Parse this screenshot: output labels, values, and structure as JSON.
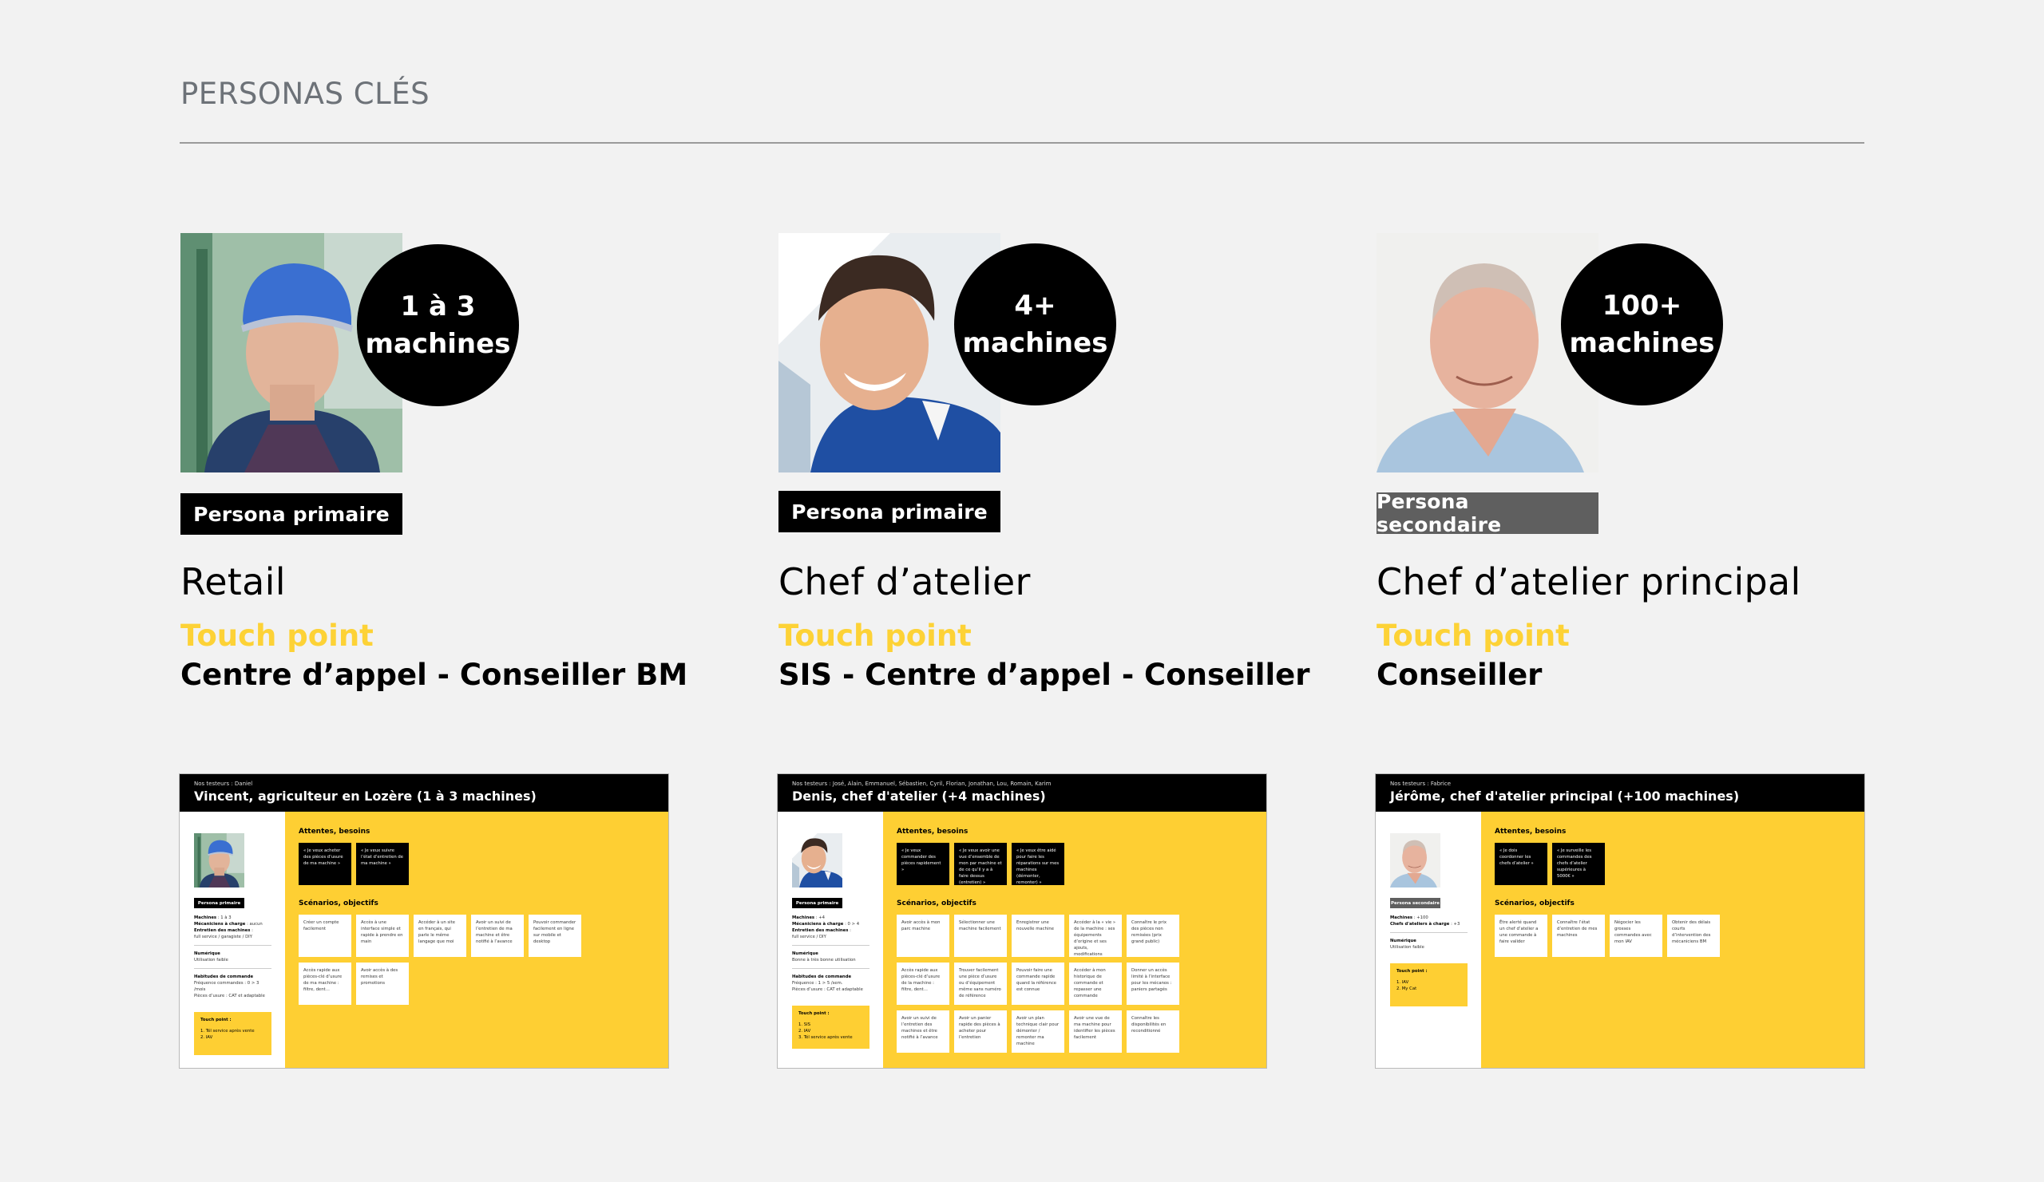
{
  "page": {
    "title": "PERSONAS CLÉS",
    "accent_color": "#fdd236",
    "background_color": "#f2f2f2"
  },
  "personas": [
    {
      "count_line1": "1 à 3",
      "count_line2": "machines",
      "badge": "Persona primaire",
      "badge_type": "primary",
      "role": "Retail",
      "touch_point_label": "Touch point",
      "touch_point_value": "Centre d’appel - Conseiller BM",
      "photo": "farmer-portrait"
    },
    {
      "count_line1": "4+",
      "count_line2": "machines",
      "badge": "Persona primaire",
      "badge_type": "primary",
      "role": "Chef d’atelier",
      "touch_point_label": "Touch point",
      "touch_point_value": "SIS - Centre d’appel - Conseiller",
      "photo": "mechanic-portrait"
    },
    {
      "count_line1": "100+",
      "count_line2": "machines",
      "badge": "Persona secondaire",
      "badge_type": "secondary",
      "role": "Chef d’atelier principal",
      "touch_point_label": "Touch point",
      "touch_point_value": "Conseiller",
      "photo": "senior-manager-portrait"
    }
  ],
  "docs": [
    {
      "testers": "Nos testeurs : Daniel",
      "title": "Vincent, agriculteur en Lozère (1 à 3 machines)",
      "badge": "Persona primaire",
      "info": [
        {
          "lines": [
            {
              "label": "Machines",
              "value": " : 1 à 3"
            },
            {
              "label": "Mécaniciens à charge",
              "value": " : aucun"
            },
            {
              "label": "Entretien des machines",
              "value": " :"
            },
            {
              "label": "",
              "value": "full service / garagiste / DIY"
            }
          ]
        },
        {
          "lines": [
            {
              "label": "Numérique",
              "value": ""
            },
            {
              "label": "",
              "value": "Utilisation faible"
            }
          ]
        },
        {
          "lines": [
            {
              "label": "Habitudes de commande",
              "value": ""
            },
            {
              "label": "",
              "value": "Fréquence commandes : 0 > 3 /mois"
            },
            {
              "label": "",
              "value": "Pièces d’usure : CAT et adaptable"
            }
          ]
        }
      ],
      "touch_point_title": "Touch point :",
      "touch_points": [
        "1. Tél service après vente",
        "2. IAV"
      ],
      "needs_title": "Attentes, besoins",
      "needs": [
        "« Je veux acheter des pièces d’usure de ma machine »",
        "« Je veux suivre l’état d’entretien de ma machine »"
      ],
      "scenarios_title": "Scénarios, objectifs",
      "scenarios": [
        "Créer un compte facilement",
        "Accès à une interface simple et rapide à prendre en main",
        "Accéder à un site en français, qui parle le même langage que moi",
        "Avoir un suivi de l’entretien de ma machine et être notifié à l’avance",
        "Pouvoir commander facilement en ligne sur mobile et desktop",
        "Accès rapide aux pièces-clé d’usure de ma machine : filtre, dent…",
        "Avoir accès à des remises et promotions"
      ]
    },
    {
      "testers": "Nos testeurs : José, Alain, Emmanuel, Sébastien, Cyril, Florian, Jonathan, Lou, Romain, Karim",
      "title": "Denis, chef d'atelier (+4 machines)",
      "badge": "Persona primaire",
      "info": [
        {
          "lines": [
            {
              "label": "Machines",
              "value": " : +4"
            },
            {
              "label": "Mécaniciens à charge",
              "value": " : 0 > 4"
            },
            {
              "label": "Entretien des machines",
              "value": " :"
            },
            {
              "label": "",
              "value": "full service / DIY"
            }
          ]
        },
        {
          "lines": [
            {
              "label": "Numérique",
              "value": ""
            },
            {
              "label": "",
              "value": "Bonne à très bonne utilisation"
            }
          ]
        },
        {
          "lines": [
            {
              "label": "Habitudes de commande",
              "value": ""
            },
            {
              "label": "",
              "value": "Fréquence : 1 > 5 /sem."
            },
            {
              "label": "",
              "value": "Pièces d’usure : CAT et adaptable"
            }
          ]
        }
      ],
      "touch_point_title": "Touch point :",
      "touch_points": [
        "1. SIS",
        "2. IAV",
        "3. Tél service après vente"
      ],
      "needs_title": "Attentes, besoins",
      "needs": [
        "« Je veux commander des pièces rapidement »",
        "« Je veux avoir une vue d’ensemble de mon par machine et de ce qu’il y a à faire dessus (entretien) »",
        "« Je veux être aidé pour faire les réparations sur mes machines (démonter, remonter) »"
      ],
      "scenarios_title": "Scénarios, objectifs",
      "scenarios": [
        "Avoir accès à mon parc machine",
        "Sélectionner une machine facilement",
        "Enregistrer une nouvelle machine",
        "Accéder à la « vie » de la machine : ses équipements d’origine et ses ajouts, modifications",
        "Connaître le prix des pièces non remisées (prix grand public)",
        "Accès rapide aux pièces-clé d’usure de la machine : filtre, dent…",
        "Trouver facilement une pièce d’usure ou d’équipement même sans numéro de référence",
        "Pouvoir faire une commande rapide quand la référence est connue",
        "Accéder à mon historique de commande et repasser une commande",
        "Donner un accès limité à l’interface pour les mécanos : paniers partagés",
        "Avoir un suivi de l’entretien des machines et être notifié à l’avance",
        "Avoir un panier rapide des pièces à acheter pour l’entretien",
        "Avoir un plan technique clair pour démonter / remonter ma machine",
        "Avoir une vue de ma machine pour identifier les pièces facilement",
        "Connaître les disponibilités en reconditionné"
      ]
    },
    {
      "testers": "Nos testeurs : Fabrice",
      "title": "Jérôme, chef d'atelier principal (+100 machines)",
      "badge": "Persona secondaire",
      "info": [
        {
          "lines": [
            {
              "label": "Machines",
              "value": " : +100"
            },
            {
              "label": "Chefs d'ateliers à charge",
              "value": " : +3"
            }
          ]
        },
        {
          "lines": [
            {
              "label": "Numérique",
              "value": ""
            },
            {
              "label": "",
              "value": "Utilisation faible"
            }
          ]
        }
      ],
      "touch_point_title": "Touch point :",
      "touch_points": [
        "1. IAV",
        "2. My Cat"
      ],
      "needs_title": "Attentes, besoins",
      "needs": [
        "« Je dois coordonner les chefs d’atelier »",
        "« Je surveille les commandes des chefs d’atelier supérieures à 5000€ »"
      ],
      "scenarios_title": "Scénarios, objectifs",
      "scenarios": [
        "Être alerté quand un chef d’atelier a une commande à faire valider",
        "Connaître l’état d’entretien de mes machines",
        "Négocier les grosses commandes avec mon IAV",
        "Obtenir des délais courts d’intervention des mécaniciens BM"
      ]
    }
  ]
}
